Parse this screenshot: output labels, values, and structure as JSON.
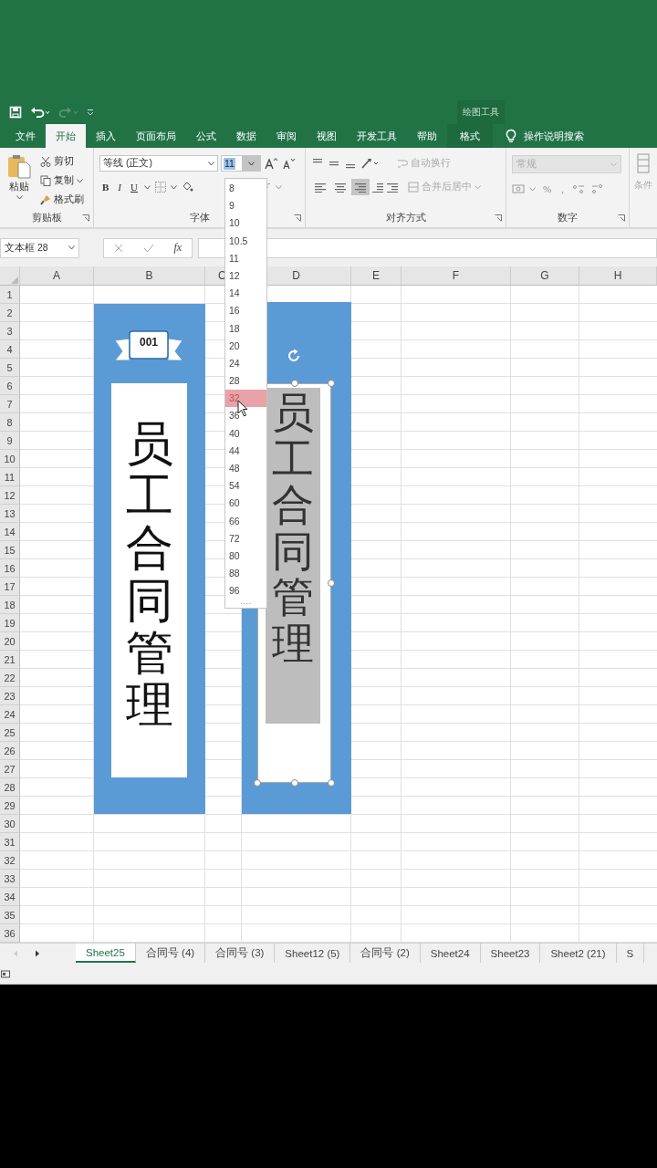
{
  "contextual_group": "绘图工具",
  "tabs": [
    {
      "label": "文件",
      "selected": false,
      "kind": "normal"
    },
    {
      "label": "开始",
      "selected": true,
      "kind": "normal"
    },
    {
      "label": "插入",
      "selected": false,
      "kind": "normal"
    },
    {
      "label": "页面布局",
      "selected": false,
      "kind": "normal"
    },
    {
      "label": "公式",
      "selected": false,
      "kind": "normal"
    },
    {
      "label": "数据",
      "selected": false,
      "kind": "normal"
    },
    {
      "label": "审阅",
      "selected": false,
      "kind": "normal"
    },
    {
      "label": "视图",
      "selected": false,
      "kind": "normal"
    },
    {
      "label": "开发工具",
      "selected": false,
      "kind": "normal"
    },
    {
      "label": "帮助",
      "selected": false,
      "kind": "normal"
    },
    {
      "label": "格式",
      "selected": false,
      "kind": "contextual"
    }
  ],
  "tell_me": "操作说明搜索",
  "ribbon": {
    "clipboard": {
      "label": "剪贴板",
      "paste": "粘贴",
      "cut": "剪切",
      "copy": "复制",
      "format_painter": "格式刷"
    },
    "font": {
      "label": "字体",
      "font_name": "等线 (正文)",
      "font_size": "11",
      "bold": "B",
      "italic": "I",
      "underline": "U"
    },
    "alignment": {
      "label": "对齐方式",
      "align_buttons": [
        {
          "kind": "left",
          "selected": false
        },
        {
          "kind": "center",
          "selected": false
        },
        {
          "kind": "right",
          "selected": true
        }
      ],
      "wrap_text": {
        "label": "自动换行",
        "disabled": true
      },
      "merge": {
        "label": "合并后居中",
        "disabled": true
      }
    },
    "number": {
      "label": "数字",
      "format": {
        "value": "常规",
        "disabled": true
      },
      "percent": "%",
      "comma": ","
    },
    "styles": {
      "label": "条件"
    }
  },
  "name_box": "文本框 28",
  "formula_bar": {
    "fx": "fx"
  },
  "columns": [
    "A",
    "B",
    "C",
    "D",
    "E",
    "F",
    "G",
    "H"
  ],
  "rows": [
    "1",
    "2",
    "3",
    "4",
    "5",
    "6",
    "7",
    "8",
    "9",
    "10",
    "11",
    "12",
    "13",
    "14",
    "15",
    "16",
    "17",
    "18",
    "19",
    "20",
    "21",
    "22",
    "23",
    "24",
    "25",
    "26",
    "27",
    "28",
    "29",
    "30",
    "31",
    "32",
    "33",
    "34",
    "35",
    "36"
  ],
  "shapes": [
    {
      "kind": "banner",
      "badge": "001",
      "text": "员工合同管理",
      "selected": false
    },
    {
      "kind": "textbox",
      "text": "员工合同管理",
      "selected": true
    }
  ],
  "font_size_menu": [
    {
      "label": "8",
      "selected": false
    },
    {
      "label": "9",
      "selected": false
    },
    {
      "label": "10",
      "selected": false
    },
    {
      "label": "10.5",
      "selected": false
    },
    {
      "label": "11",
      "selected": false
    },
    {
      "label": "12",
      "selected": false
    },
    {
      "label": "14",
      "selected": false
    },
    {
      "label": "16",
      "selected": false
    },
    {
      "label": "18",
      "selected": false
    },
    {
      "label": "20",
      "selected": false
    },
    {
      "label": "24",
      "selected": false
    },
    {
      "label": "28",
      "selected": false
    },
    {
      "label": "32",
      "selected": true
    },
    {
      "label": "36",
      "selected": false
    },
    {
      "label": "40",
      "selected": false
    },
    {
      "label": "44",
      "selected": false
    },
    {
      "label": "48",
      "selected": false
    },
    {
      "label": "54",
      "selected": false
    },
    {
      "label": "60",
      "selected": false
    },
    {
      "label": "66",
      "selected": false
    },
    {
      "label": "72",
      "selected": false
    },
    {
      "label": "80",
      "selected": false
    },
    {
      "label": "88",
      "selected": false
    },
    {
      "label": "96",
      "selected": false
    }
  ],
  "sheet_tabs": [
    {
      "label": "Sheet25",
      "selected": true
    },
    {
      "label": "合同号 (4)",
      "selected": false
    },
    {
      "label": "合同号 (3)",
      "selected": false
    },
    {
      "label": "Sheet12 (5)",
      "selected": false
    },
    {
      "label": "合同号 (2)",
      "selected": false
    },
    {
      "label": "Sheet24",
      "selected": false
    },
    {
      "label": "Sheet23",
      "selected": false
    },
    {
      "label": "Sheet2 (21)",
      "selected": false
    },
    {
      "label": "S",
      "selected": false
    }
  ]
}
